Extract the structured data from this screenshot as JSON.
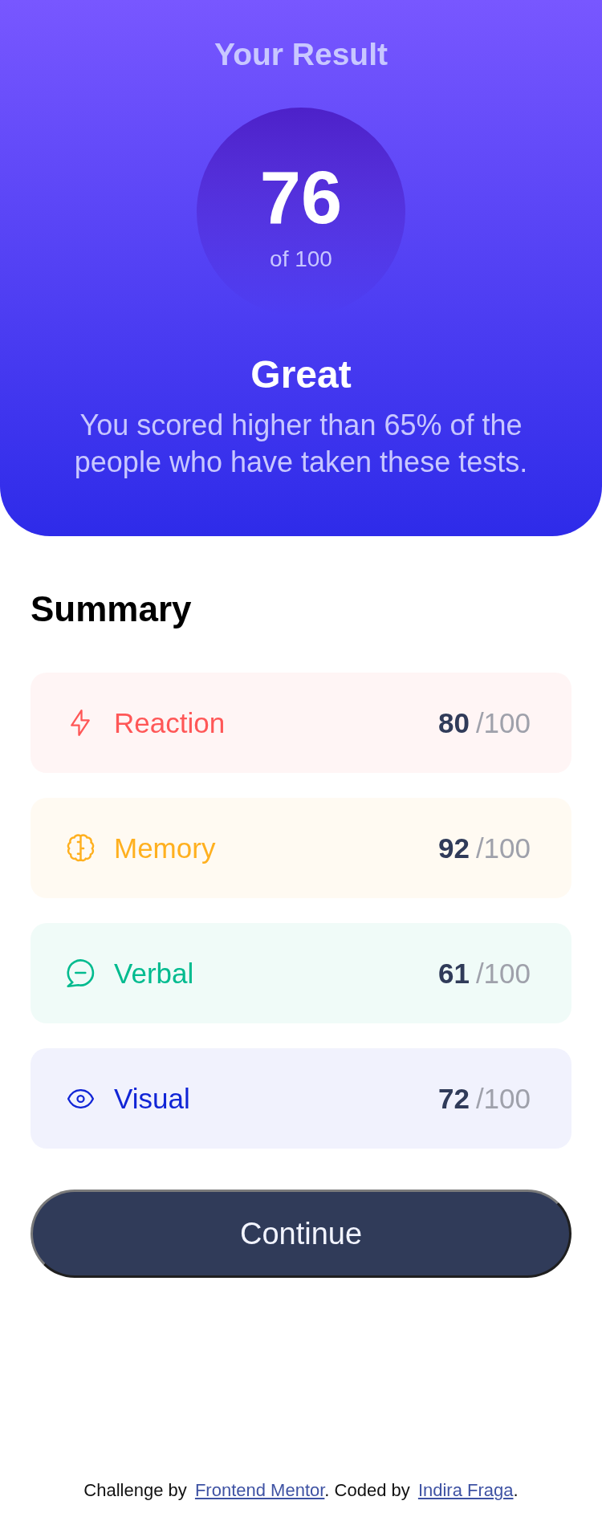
{
  "result": {
    "title": "Your Result",
    "score": "76",
    "score_total": "of 100",
    "rating": "Great",
    "description": "You scored higher than 65% of the people who have taken these tests."
  },
  "summary": {
    "title": "Summary",
    "items": [
      {
        "kind": "bolt",
        "label": "Reaction",
        "score": "80",
        "total": "/100",
        "color": "#ff5757"
      },
      {
        "kind": "brain",
        "label": "Memory",
        "score": "92",
        "total": "/100",
        "color": "#ffb01f"
      },
      {
        "kind": "speech",
        "label": "Verbal",
        "score": "61",
        "total": "/100",
        "color": "#00bb8f"
      },
      {
        "kind": "eye",
        "label": "Visual",
        "score": "72",
        "total": "/100",
        "color": "#1125d6"
      }
    ]
  },
  "button": {
    "label": "Continue"
  },
  "footer": {
    "parts": [
      {
        "kind": "text",
        "text": "Challenge by"
      },
      {
        "kind": "link",
        "text": "Frontend Mentor"
      },
      {
        "kind": "text",
        "text": ". Coded by"
      },
      {
        "kind": "link",
        "text": "Indira Fraga"
      },
      {
        "kind": "text",
        "text": "."
      }
    ]
  }
}
